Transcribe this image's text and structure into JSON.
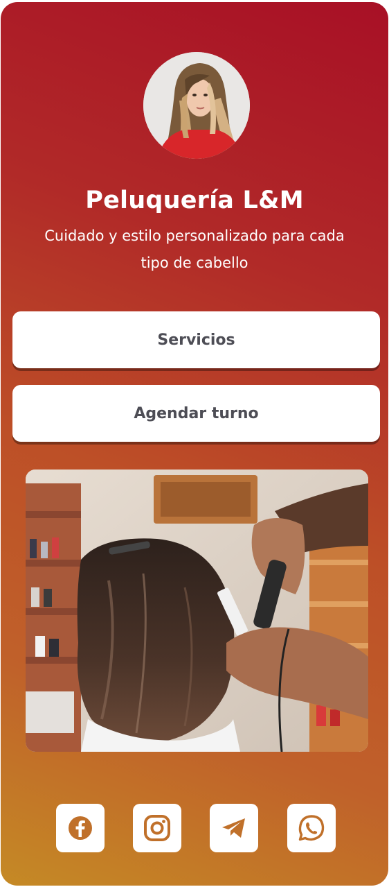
{
  "profile": {
    "name": "Peluquería L&M",
    "tagline": "Cuidado y estilo personalizado para cada tipo de cabello",
    "avatar_icon": "woman-portrait"
  },
  "links": [
    {
      "label": "Servicios"
    },
    {
      "label": "Agendar turno"
    }
  ],
  "photo": {
    "icon": "hairdresser-curling-hair-photo"
  },
  "social": [
    {
      "icon": "facebook-icon"
    },
    {
      "icon": "instagram-icon"
    },
    {
      "icon": "telegram-icon"
    },
    {
      "icon": "whatsapp-icon"
    }
  ],
  "colors": {
    "gradient_top": "#a81026",
    "gradient_bottom": "#c58a25",
    "icon_color": "#c0702a",
    "button_text": "#4d4d55"
  }
}
